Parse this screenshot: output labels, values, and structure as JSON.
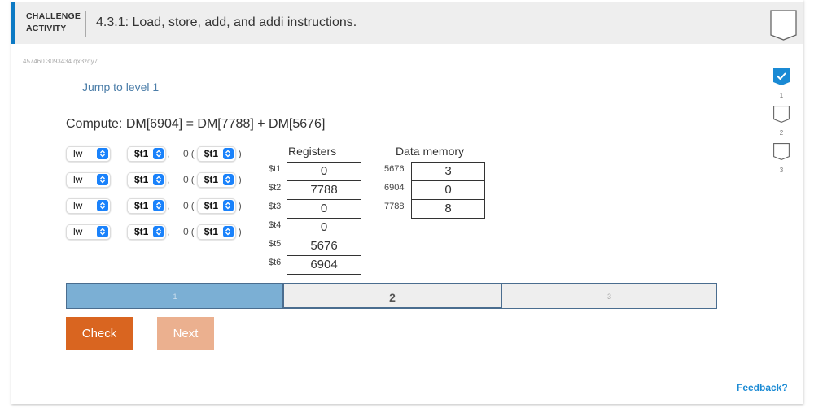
{
  "header": {
    "label_line1": "CHALLENGE",
    "label_line2": "ACTIVITY",
    "title": "4.3.1: Load, store, add, and addi instructions."
  },
  "activity_id": "457460.3093434.qx3zqy7",
  "jump_link": "Jump to level 1",
  "compute_text": "Compute: DM[6904] = DM[7788] + DM[5676]",
  "instructions": [
    {
      "op": "lw",
      "rt": "$t1",
      "comma": ",",
      "offset": "0",
      "open_paren": "(",
      "rs": "$t1",
      "close_paren": ")"
    },
    {
      "op": "lw",
      "rt": "$t1",
      "comma": ",",
      "offset": "0",
      "open_paren": "(",
      "rs": "$t1",
      "close_paren": ")"
    },
    {
      "op": "lw",
      "rt": "$t1",
      "comma": ",",
      "offset": "0",
      "open_paren": "(",
      "rs": "$t1",
      "close_paren": ")"
    },
    {
      "op": "lw",
      "rt": "$t1",
      "comma": ",",
      "offset": "0",
      "open_paren": "(",
      "rs": "$t1",
      "close_paren": ")"
    }
  ],
  "registers": {
    "title": "Registers",
    "rows": [
      {
        "name": "$t1",
        "value": "0"
      },
      {
        "name": "$t2",
        "value": "7788"
      },
      {
        "name": "$t3",
        "value": "0"
      },
      {
        "name": "$t4",
        "value": "0"
      },
      {
        "name": "$t5",
        "value": "5676"
      },
      {
        "name": "$t6",
        "value": "6904"
      }
    ]
  },
  "data_memory": {
    "title": "Data memory",
    "rows": [
      {
        "address": "5676",
        "value": "3"
      },
      {
        "address": "6904",
        "value": "0"
      },
      {
        "address": "7788",
        "value": "8"
      }
    ]
  },
  "levels": [
    {
      "label": "1",
      "state": "done"
    },
    {
      "label": "2",
      "state": "current"
    },
    {
      "label": "3",
      "state": "future"
    }
  ],
  "buttons": {
    "check": "Check",
    "next": "Next"
  },
  "feedback": "Feedback?",
  "side_levels": [
    {
      "label": "1",
      "completed": true
    },
    {
      "label": "2",
      "completed": false
    },
    {
      "label": "3",
      "completed": false
    }
  ],
  "colors": {
    "accent": "#0d7ac4",
    "check_button": "#d96520",
    "next_button_disabled": "#ebb08f",
    "level_done": "#7bafd4",
    "select_arrow": "#1a82fb",
    "feedback_link": "#1a8ad4"
  }
}
